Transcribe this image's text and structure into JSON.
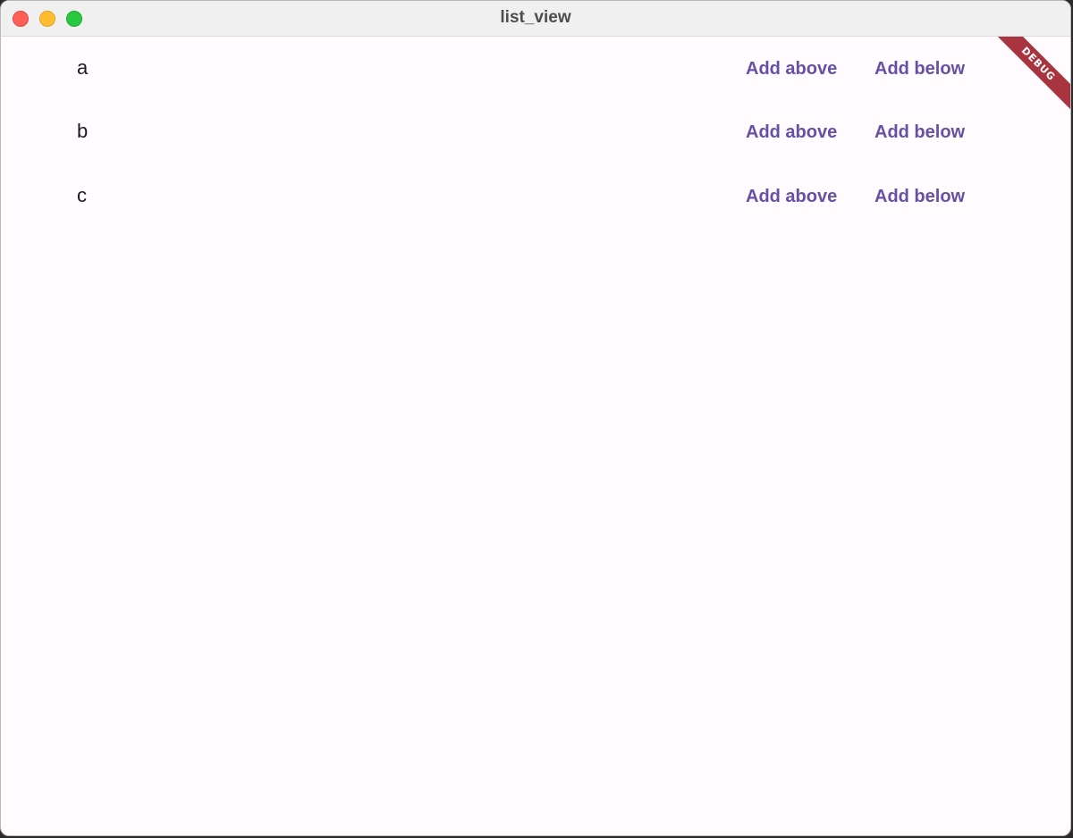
{
  "window": {
    "title": "list_view"
  },
  "list": {
    "items": [
      {
        "label": "a",
        "add_above": "Add above",
        "add_below": "Add below"
      },
      {
        "label": "b",
        "add_above": "Add above",
        "add_below": "Add below"
      },
      {
        "label": "c",
        "add_above": "Add above",
        "add_below": "Add below"
      }
    ]
  },
  "banner": {
    "text": "DEBUG"
  },
  "colors": {
    "accent": "#6750a4",
    "background": "#fffbfe",
    "banner": "#a8343f"
  }
}
